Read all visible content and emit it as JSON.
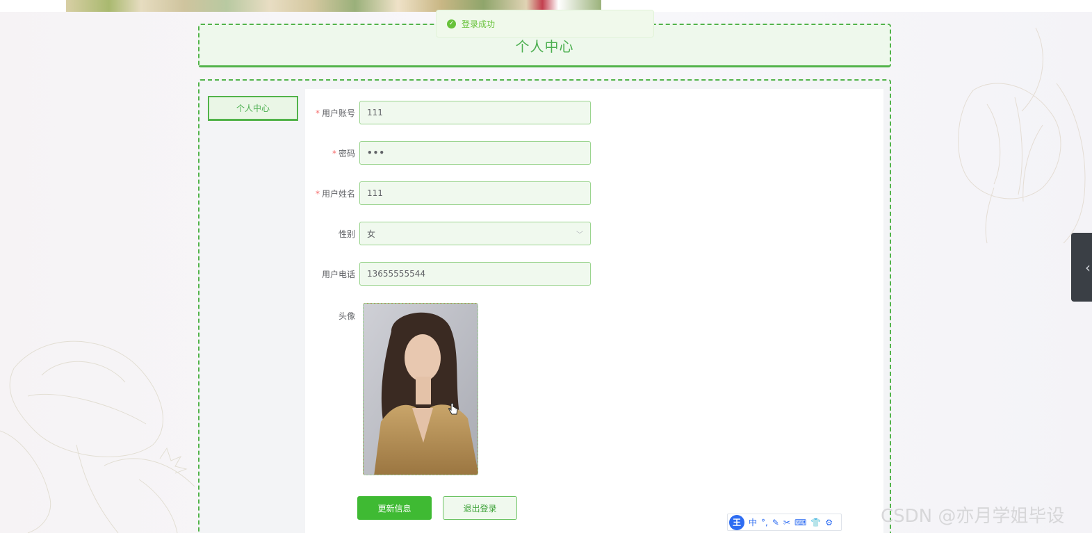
{
  "toast": {
    "message": "登录成功"
  },
  "header": {
    "title": "个人中心"
  },
  "sidebar": {
    "tab_label": "个人中心"
  },
  "form": {
    "account": {
      "label": "用户账号",
      "value": "111"
    },
    "password": {
      "label": "密码",
      "value": "•••"
    },
    "name": {
      "label": "用户姓名",
      "value": "111"
    },
    "gender": {
      "label": "性别",
      "value": "女"
    },
    "phone": {
      "label": "用户电话",
      "value": "13655555544"
    },
    "avatar": {
      "label": "头像"
    },
    "required_mark": "*"
  },
  "buttons": {
    "update": "更新信息",
    "logout": "退出登录"
  },
  "ime": {
    "logo": "王",
    "items": [
      "中",
      "°,",
      "✎",
      "✂",
      "⌨",
      "👕",
      "⚙"
    ]
  },
  "watermark": "CSDN @亦月学姐毕设",
  "colors": {
    "accent": "#52b34a",
    "primary_button": "#3fba33",
    "required": "#f56c6c"
  },
  "icons": {
    "toast": "check-circle-icon",
    "select": "chevron-down-icon",
    "handle": "chevron-left-icon"
  }
}
